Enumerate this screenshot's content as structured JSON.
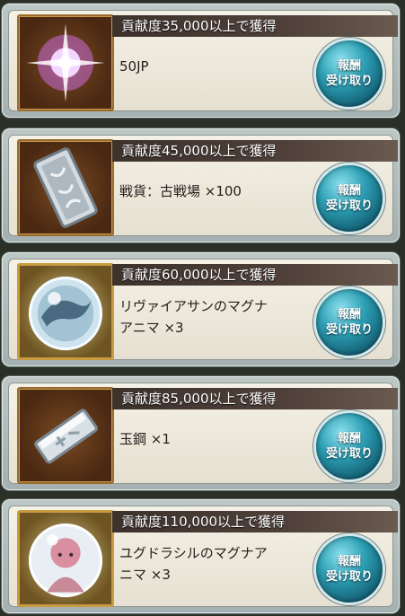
{
  "rewards": [
    {
      "threshold": "貢献度35,000以上で獲得",
      "item_lines": [
        "50JP"
      ],
      "item_icon": "purple-star-orb-icon",
      "button": [
        "報酬",
        "受け取り"
      ]
    },
    {
      "threshold": "貢献度45,000以上で獲得",
      "item_lines": [
        "戦貨：古戦場 ×100"
      ],
      "item_icon": "silver-war-medal-icon",
      "button": [
        "報酬",
        "受け取り"
      ]
    },
    {
      "threshold": "貢献度60,000以上で獲得",
      "item_lines": [
        "リヴァイアサンのマグナ",
        "アニマ ×3"
      ],
      "item_icon": "leviathan-anima-orb-icon",
      "button": [
        "報酬",
        "受け取り"
      ]
    },
    {
      "threshold": "貢献度85,000以上で獲得",
      "item_lines": [
        "玉鋼 ×1"
      ],
      "item_icon": "steel-ingot-icon",
      "button": [
        "報酬",
        "受け取り"
      ]
    },
    {
      "threshold": "貢献度110,000以上で獲得",
      "item_lines": [
        "ユグドラシルのマグナア",
        "ニマ ×3"
      ],
      "item_icon": "yggdrasil-anima-orb-icon",
      "button": [
        "報酬",
        "受け取り"
      ]
    }
  ]
}
